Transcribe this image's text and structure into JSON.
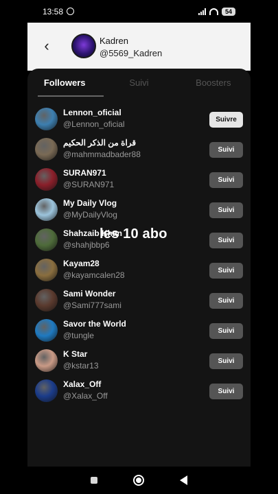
{
  "statusbar": {
    "time": "13:58",
    "battery": "54"
  },
  "profile": {
    "name": "Kadren",
    "handle": "@5569_Kadren"
  },
  "tabs": [
    {
      "label": "Followers",
      "active": true
    },
    {
      "label": "Suivi",
      "active": false
    },
    {
      "label": "Boosters",
      "active": false
    }
  ],
  "users": [
    {
      "name": "Lennon_oficial",
      "handle": "@Lennon_oficial",
      "button": "Suivre",
      "avatar_color": "#3d7fb0"
    },
    {
      "name": "قراة من الذكر الحكيم",
      "handle": "@mahmmadbader88",
      "button": "Suivi",
      "avatar_color": "#7a6a55"
    },
    {
      "name": "SURAN971",
      "handle": "@SURAN971",
      "button": "Suivi",
      "avatar_color": "#8a1f2a"
    },
    {
      "name": "My Daily Vlog",
      "handle": "@MyDailyVlog",
      "button": "Suivi",
      "avatar_color": "#9cc4dc"
    },
    {
      "name": "Shahzaib Khan",
      "handle": "@shahjbbp6",
      "button": "Suivi",
      "avatar_color": "#4e6b3a"
    },
    {
      "name": "Kayam28",
      "handle": "@kayamcalen28",
      "button": "Suivi",
      "avatar_color": "#8a6e3f"
    },
    {
      "name": "Sami Wonder",
      "handle": "@Sami777sami",
      "button": "Suivi",
      "avatar_color": "#5a3a2e"
    },
    {
      "name": "Savor the World",
      "handle": "@tungle",
      "button": "Suivi",
      "avatar_color": "#1f7ac1"
    },
    {
      "name": "K Star",
      "handle": "@kstar13",
      "button": "Suivi",
      "avatar_color": "#c99a86"
    },
    {
      "name": "Xalax_Off",
      "handle": "@Xalax_Off",
      "button": "Suivi",
      "avatar_color": "#1b3c8a"
    }
  ],
  "overlay_caption": "les 10 abo"
}
